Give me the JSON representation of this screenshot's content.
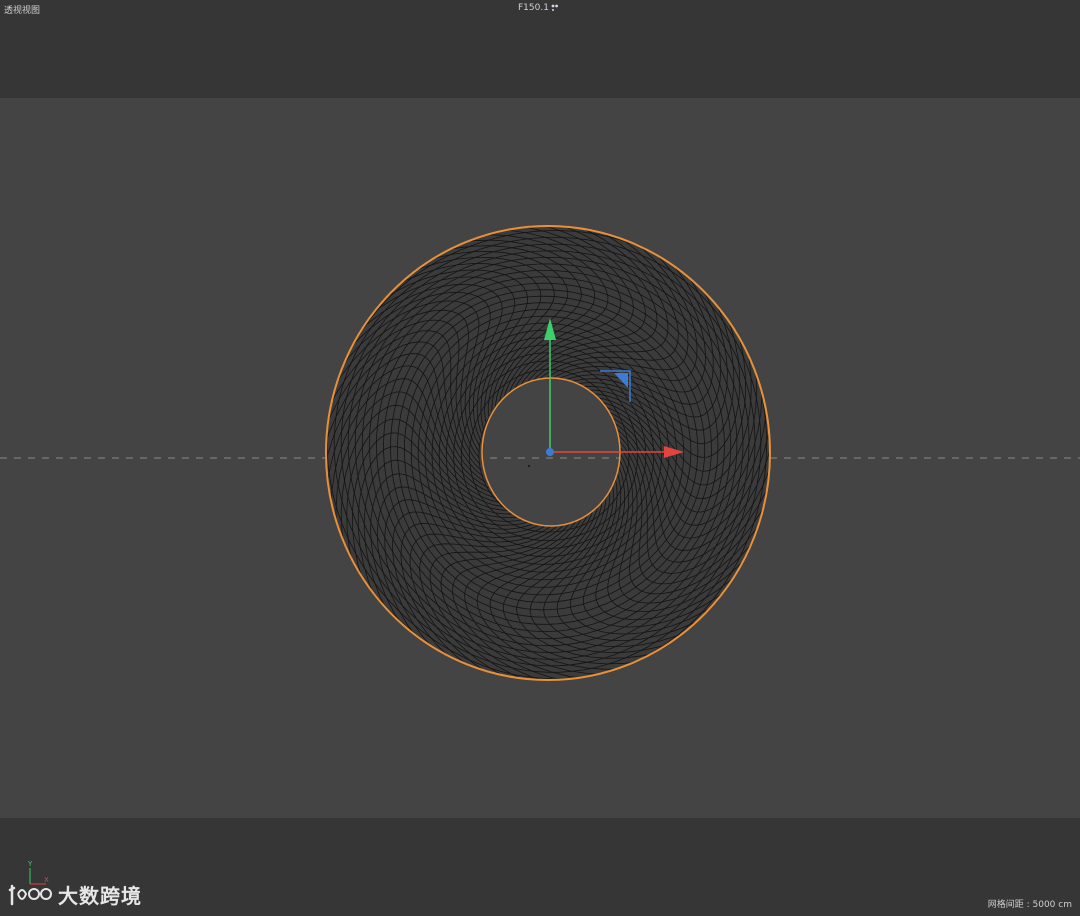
{
  "viewport": {
    "view_name": "透视视图",
    "camera_label": "F150.1",
    "grid_spacing_label": "网格间距 : 5000 cm"
  },
  "gizmo": {
    "x_axis_color": "#e0463f",
    "y_axis_color": "#3ccf6a",
    "z_axis_color": "#3c7bd6",
    "selection_color": "#e8913a"
  },
  "axis_indicator": {
    "y_label": "Y",
    "x_label": "X"
  },
  "watermark": {
    "text": "大数跨境"
  }
}
